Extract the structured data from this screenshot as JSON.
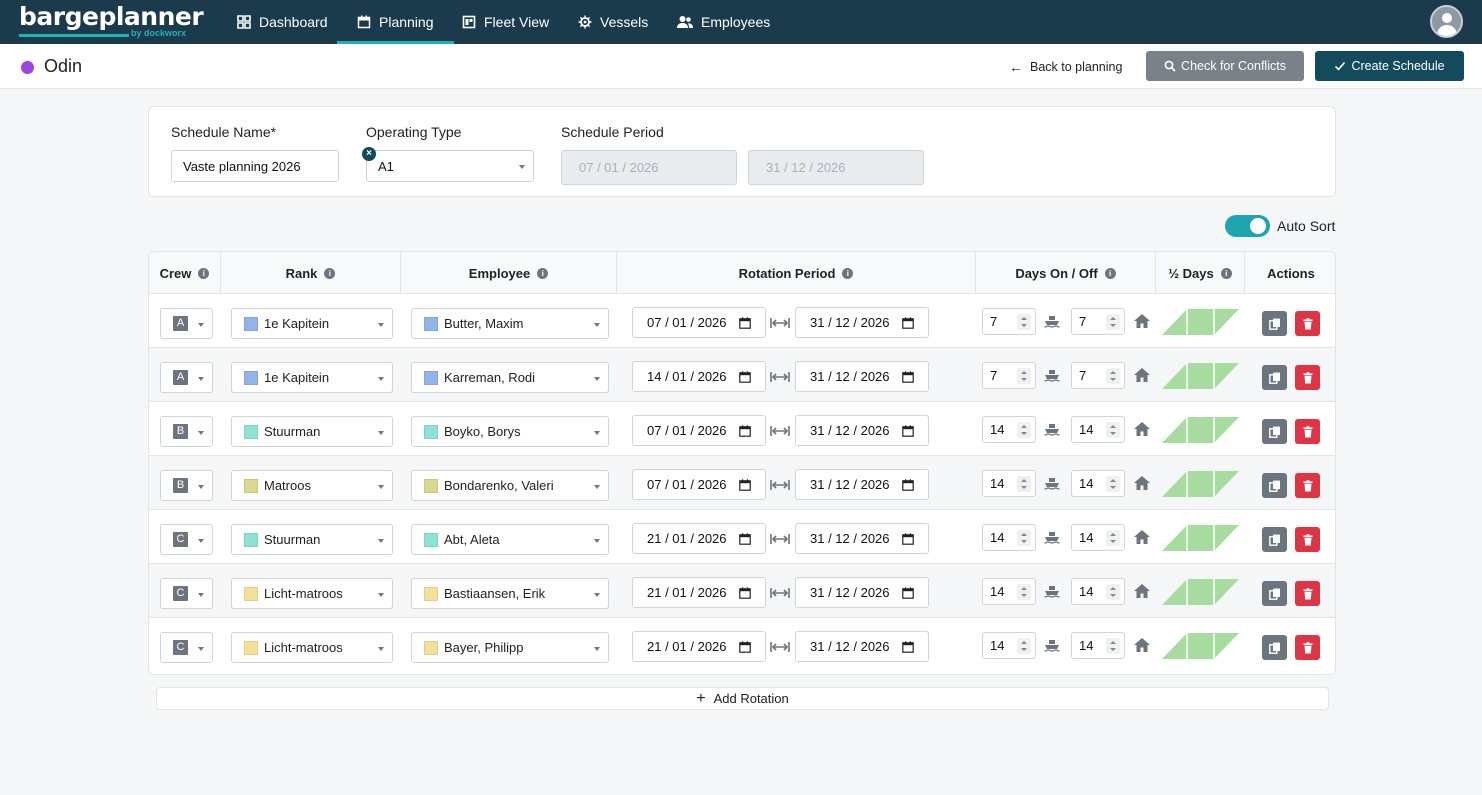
{
  "app": {
    "brand": "bargeplanner",
    "brand_sub": "by dockworx"
  },
  "nav": {
    "items": [
      {
        "label": "Dashboard",
        "icon": "dashboard-icon"
      },
      {
        "label": "Planning",
        "icon": "calendar-icon",
        "active": true
      },
      {
        "label": "Fleet View",
        "icon": "fleet-icon"
      },
      {
        "label": "Vessels",
        "icon": "ship-wheel-icon"
      },
      {
        "label": "Employees",
        "icon": "users-icon"
      }
    ]
  },
  "header": {
    "vessel_name": "Odin",
    "vessel_color": "#9b45e4",
    "back_label": "Back to planning",
    "conflicts_label": "Check for Conflicts",
    "create_label": "Create Schedule"
  },
  "form": {
    "name_label": "Schedule Name*",
    "name_value": "Vaste planning 2026",
    "type_label": "Operating Type",
    "type_value": "A1",
    "period_label": "Schedule Period",
    "period_start": "07 / 01 / 2026",
    "period_end": "31 / 12 / 2026"
  },
  "auto_sort": {
    "label": "Auto Sort",
    "on": true
  },
  "table": {
    "headers": {
      "crew": "Crew",
      "rank": "Rank",
      "employee": "Employee",
      "rotation": "Rotation Period",
      "days": "Days On / Off",
      "half": "½ Days",
      "actions": "Actions"
    },
    "rows": [
      {
        "crew": "A",
        "rank": "1e Kapitein",
        "rank_color": "#93b4e8",
        "employee": "Butter, Maxim",
        "emp_color": "#93b4e8",
        "start": "07 / 01 / 2026",
        "end": "31 / 12 / 2026",
        "on": "7",
        "off": "7"
      },
      {
        "crew": "A",
        "rank": "1e Kapitein",
        "rank_color": "#93b4e8",
        "employee": "Karreman, Rodi",
        "emp_color": "#93b4e8",
        "start": "14 / 01 / 2026",
        "end": "31 / 12 / 2026",
        "on": "7",
        "off": "7"
      },
      {
        "crew": "B",
        "rank": "Stuurman",
        "rank_color": "#8fe3d6",
        "employee": "Boyko, Borys",
        "emp_color": "#8fe3d6",
        "start": "07 / 01 / 2026",
        "end": "31 / 12 / 2026",
        "on": "14",
        "off": "14"
      },
      {
        "crew": "B",
        "rank": "Matroos",
        "rank_color": "#d9d88e",
        "employee": "Bondarenko, Valeri",
        "emp_color": "#d9d88e",
        "start": "07 / 01 / 2026",
        "end": "31 / 12 / 2026",
        "on": "14",
        "off": "14"
      },
      {
        "crew": "C",
        "rank": "Stuurman",
        "rank_color": "#8fe3d6",
        "employee": "Abt, Aleta",
        "emp_color": "#8fe3d6",
        "start": "21 / 01 / 2026",
        "end": "31 / 12 / 2026",
        "on": "14",
        "off": "14"
      },
      {
        "crew": "C",
        "rank": "Licht-matroos",
        "rank_color": "#f3e19b",
        "employee": "Bastiaansen, Erik",
        "emp_color": "#f3e19b",
        "start": "21 / 01 / 2026",
        "end": "31 / 12 / 2026",
        "on": "14",
        "off": "14"
      },
      {
        "crew": "C",
        "rank": "Licht-matroos",
        "rank_color": "#f3e19b",
        "employee": "Bayer, Philipp",
        "emp_color": "#f3e19b",
        "start": "21 / 01 / 2026",
        "end": "31 / 12 / 2026",
        "on": "14",
        "off": "14"
      }
    ]
  },
  "add_rotation_label": "Add Rotation",
  "colors": {
    "nav_bg": "#1b3a4b",
    "accent": "#1fb0b8",
    "primary": "#134a5c",
    "danger": "#dc3545",
    "half_green": "#a8dba0"
  }
}
